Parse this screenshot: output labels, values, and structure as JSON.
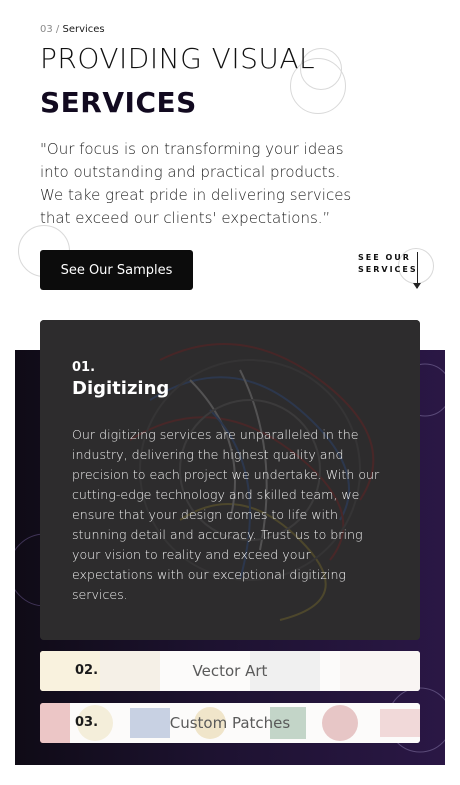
{
  "breadcrumb": {
    "number": "03",
    "separator": " / ",
    "label": "Services"
  },
  "heading": {
    "line1": "PROVIDING VISUAL",
    "line2": "SERVICES"
  },
  "quote": "\"Our focus is on transforming your ideas into outstanding and practical products. We take great pride in delivering services that exceed our clients' expectations.”",
  "cta": {
    "samples_label": "See Our Samples",
    "see_services_label": "SEE OUR SERVICES"
  },
  "colors": {
    "panel_dark": "#0f0b16",
    "panel_purple": "#2a1745",
    "button": "#0c0c0c"
  },
  "services": [
    {
      "number": "01.",
      "title": "Digitizing",
      "description": "Our digitizing services are unparalleled in the industry, delivering the highest quality and precision to each project we undertake. With our cutting-edge technology and skilled team, we ensure that your design comes to life with stunning detail and accuracy. Trust us to bring your vision to reality and exceed your expectations with our exceptional digitizing services."
    },
    {
      "number": "02.",
      "title": "Vector Art"
    },
    {
      "number": "03.",
      "title": "Custom Patches"
    }
  ]
}
